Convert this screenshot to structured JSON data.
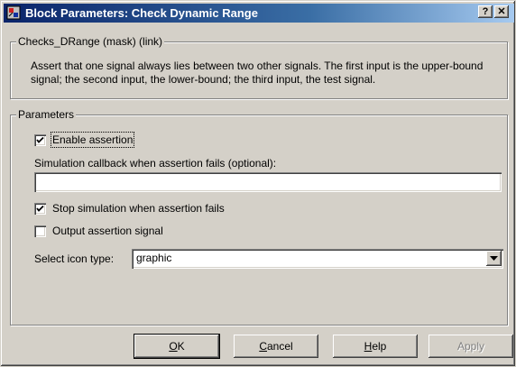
{
  "window": {
    "title": "Block Parameters: Check  Dynamic Range",
    "help_glyph": "?",
    "close_glyph": "✕",
    "icon": "simulink-block-icon"
  },
  "mask_group": {
    "legend": "Checks_DRange (mask) (link)",
    "description": "Assert that one signal always lies between two other signals.  The first input is the upper-bound signal; the second input, the lower-bound; the third input, the test signal."
  },
  "parameters": {
    "legend": "Parameters",
    "enable_assertion": {
      "label": "Enable assertion",
      "checked": true
    },
    "callback_label": "Simulation callback when assertion fails (optional):",
    "callback_value": "",
    "stop_simulation": {
      "label": "Stop simulation when assertion fails",
      "checked": true
    },
    "output_signal": {
      "label": "Output assertion signal",
      "checked": false
    },
    "icon_type_label": "Select icon type:",
    "icon_type_value": "graphic"
  },
  "buttons": {
    "ok_accel": "O",
    "ok_rest": "K",
    "cancel_accel": "C",
    "cancel_rest": "ancel",
    "help_accel": "H",
    "help_rest": "elp",
    "apply": "Apply"
  }
}
